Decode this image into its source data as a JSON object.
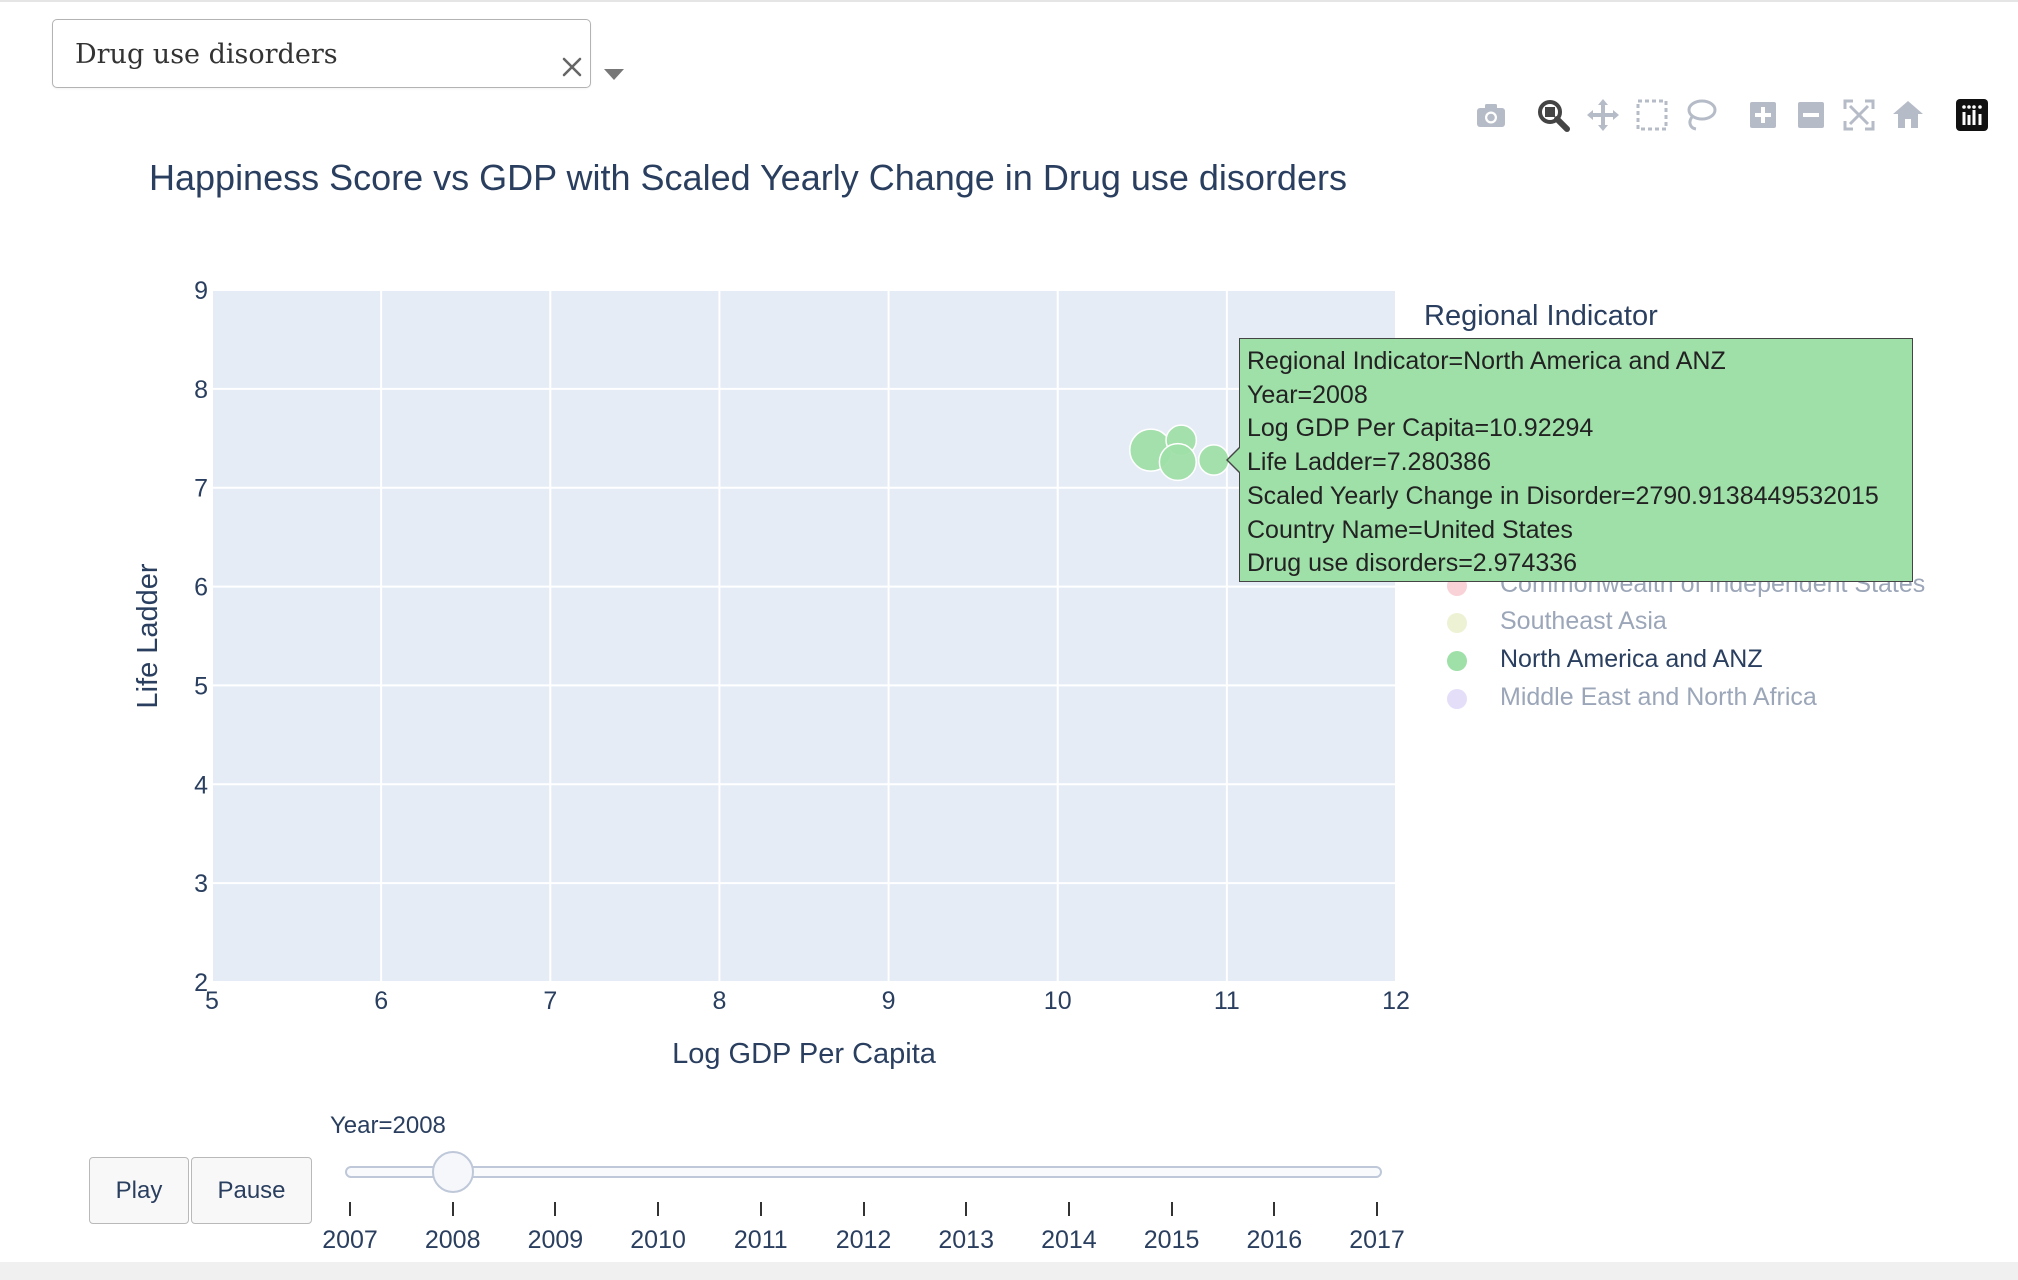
{
  "dropdown": {
    "value": "Drug use disorders"
  },
  "modebar": {
    "buttons": [
      "camera-icon",
      "zoom-icon",
      "pan-icon",
      "box-select-icon",
      "lasso-select-icon",
      "zoom-in-icon",
      "zoom-out-icon",
      "autoscale-icon",
      "reset-axes-icon",
      "plotly-logo-icon"
    ]
  },
  "chart_data": {
    "type": "scatter",
    "title": "Happiness Score vs GDP with Scaled Yearly Change in Drug use disorders",
    "xlabel": "Log GDP Per Capita",
    "ylabel": "Life Ladder",
    "xlim": [
      5,
      12
    ],
    "ylim": [
      2,
      9
    ],
    "xticks": [
      "5",
      "6",
      "7",
      "8",
      "9",
      "10",
      "11",
      "12"
    ],
    "yticks": [
      "2",
      "3",
      "4",
      "5",
      "6",
      "7",
      "8",
      "9"
    ],
    "grid": true,
    "series": [
      {
        "name": "North America and ANZ",
        "color": "#9fdfa8",
        "points": [
          {
            "x": 10.55,
            "y": 7.38,
            "size": 1.0
          },
          {
            "x": 10.73,
            "y": 7.48,
            "size": 0.55
          },
          {
            "x": 10.71,
            "y": 7.26,
            "size": 0.8
          },
          {
            "x": 10.92294,
            "y": 7.280386,
            "size": 0.55
          }
        ]
      }
    ],
    "legend": {
      "title": "Regional Indicator",
      "placement": "right",
      "items": [
        {
          "label": "Commonwealth of Independent States",
          "color": "#f6c7cc",
          "active": false
        },
        {
          "label": "Southeast Asia",
          "color": "#e9efc9",
          "active": false
        },
        {
          "label": "North America and ANZ",
          "color": "#9fdfa8",
          "active": true
        },
        {
          "label": "Middle East and North Africa",
          "color": "#ddd6f7",
          "active": false
        }
      ]
    },
    "tooltip": {
      "lines": [
        "Regional Indicator=North America and ANZ",
        "Year=2008",
        "Log GDP Per Capita=10.92294",
        "Life Ladder=7.280386",
        "Scaled Yearly Change in Disorder=2790.9138449532015",
        "Country Name=United States",
        "Drug use disorders=2.974336"
      ]
    }
  },
  "animation": {
    "play_label": "Play",
    "pause_label": "Pause",
    "current_label": "Year=2008",
    "current_year": "2008",
    "years": [
      "2007",
      "2008",
      "2009",
      "2010",
      "2011",
      "2012",
      "2013",
      "2014",
      "2015",
      "2016",
      "2017"
    ]
  }
}
